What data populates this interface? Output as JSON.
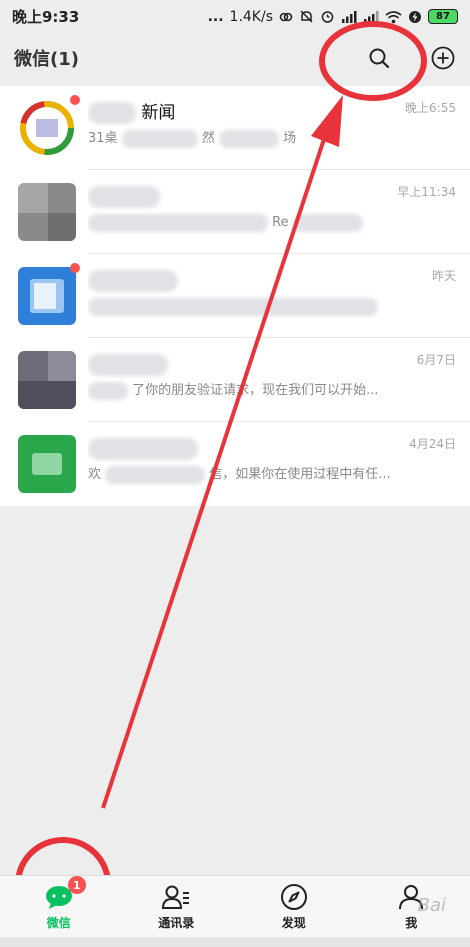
{
  "status_bar": {
    "time": "晚上9:33",
    "dots": "...",
    "speed": "1.4K/s",
    "battery": "87"
  },
  "header": {
    "title": "微信(1)"
  },
  "chats": [
    {
      "name_visible": "新闻",
      "snippet_visible": "31桌",
      "snippet_visible_2": "然",
      "snippet_visible_3": "场",
      "time": "晚上6:55",
      "unread": true,
      "avatar_color": "#e9b200"
    },
    {
      "name_visible": "",
      "snippet_visible": "Re",
      "time": "早上11:34",
      "unread": false,
      "avatar_color": "#8a8a8a"
    },
    {
      "name_visible": "",
      "snippet_visible": "",
      "time": "昨天",
      "unread": true,
      "avatar_color": "#2f7fd8"
    },
    {
      "name_visible": "",
      "snippet_visible": "了你的朋友验证请求，现在我们可以开始...",
      "time": "6月7日",
      "unread": false,
      "avatar_color": "#6b6b7a"
    },
    {
      "name_visible": "",
      "snippet_visible": "欢",
      "snippet_visible_2": "信，如果你在使用过程中有任...",
      "time": "4月24日",
      "unread": false,
      "avatar_color": "#2aa64b"
    }
  ],
  "tabs": [
    {
      "label": "微信",
      "icon": "chat-bubble-icon",
      "badge": "1"
    },
    {
      "label": "通讯录",
      "icon": "contacts-icon"
    },
    {
      "label": "发现",
      "icon": "compass-icon"
    },
    {
      "label": "我",
      "icon": "person-icon"
    }
  ],
  "watermark": "Bai",
  "colors": {
    "accent": "#07c160",
    "badge": "#fa5151",
    "annotation": "#e8333a"
  }
}
